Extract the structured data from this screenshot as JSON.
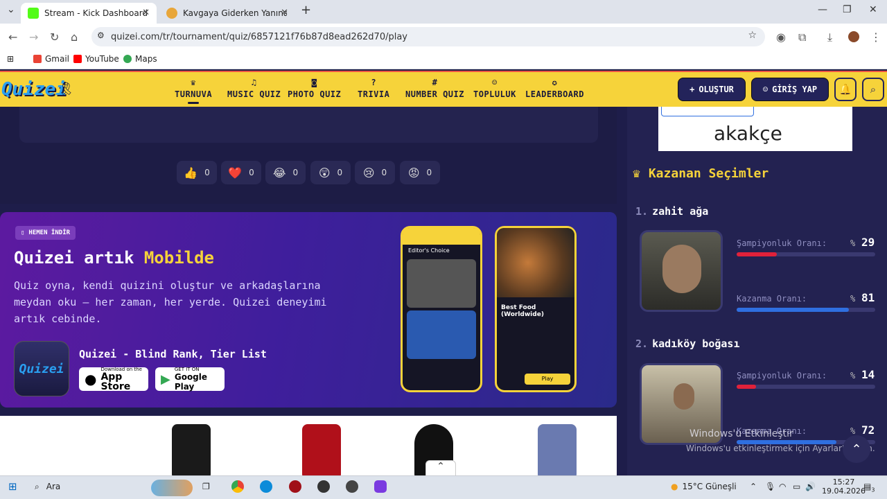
{
  "browser": {
    "tabs": [
      {
        "title": "Stream - Kick Dashboard",
        "favicon_color": "#53fc18"
      },
      {
        "title": "Kavgaya Giderken Yanına Kimi Al",
        "favicon_color": "#e8a63a"
      }
    ],
    "url": "quizei.com/tr/tournament/quiz/6857121f76b87d8ead262d70/play",
    "bookmarks": [
      "Gmail",
      "YouTube",
      "Maps"
    ]
  },
  "site": {
    "logo": "Quizei",
    "nav": [
      {
        "label": "TURNUVA",
        "icon": "trophy-icon"
      },
      {
        "label": "MUSIC QUIZ",
        "icon": "music-icon"
      },
      {
        "label": "PHOTO QUIZ",
        "icon": "camera-icon"
      },
      {
        "label": "TRIVIA",
        "icon": "question-icon"
      },
      {
        "label": "NUMBER QUIZ",
        "icon": "hash-icon"
      },
      {
        "label": "TOPLULUK",
        "icon": "users-icon"
      },
      {
        "label": "LEADERBOARD",
        "icon": "medal-icon"
      }
    ],
    "create_label": "OLUŞTUR",
    "login_label": "GİRİŞ YAP"
  },
  "reactions": [
    {
      "emoji": "👍",
      "count": "0"
    },
    {
      "emoji": "❤️",
      "count": "0"
    },
    {
      "emoji": "😂",
      "count": "0"
    },
    {
      "emoji": "😲",
      "count": "0"
    },
    {
      "emoji": "😢",
      "count": "0"
    },
    {
      "emoji": "😡",
      "count": "0"
    }
  ],
  "promo": {
    "badge": "HEMEN İNDİR",
    "title_prefix": "Quizei artık ",
    "title_highlight": "Mobilde",
    "description": "Quiz oyna, kendi quizini oluştur ve arkadaşlarına meydan oku — her zaman, her yerde. Quizei deneyimi artık cebinde.",
    "app_name": "Quizei - Blind Rank, Tier List",
    "app_icon_text": "Quizei",
    "appstore_small": "Download on the",
    "appstore_big": "App Store",
    "googleplay_small": "GET IT ON",
    "googleplay_big": "Google Play",
    "phone1_header": "Editor's Choice",
    "phone2_title": "Best Food (Worldwide)",
    "phone2_play": "Play"
  },
  "ad": {
    "brand": "akakçe"
  },
  "winners": {
    "title": "Kazanan Seçimler",
    "champion_label": "Şampiyonluk Oranı:",
    "win_label": "Kazanma Oranı:",
    "pct_sign": "%",
    "items": [
      {
        "rank": "1.",
        "name": "zahit ağa",
        "champion": 29,
        "win": 81
      },
      {
        "rank": "2.",
        "name": "kadıköy boğası",
        "champion": 14,
        "win": 72
      }
    ],
    "champion_color": "#e0213a",
    "win_color": "#2f6fe0"
  },
  "overlay": {
    "activate_title": "Windows'u Etkinleştir",
    "activate_sub": "Windows'u etkinleştirmek için Ayarlar'a gidin."
  },
  "taskbar": {
    "search": "Ara",
    "weather": "15°C  Güneşli",
    "time": "15:27",
    "date": "19.04.2026",
    "notifications": "3"
  }
}
